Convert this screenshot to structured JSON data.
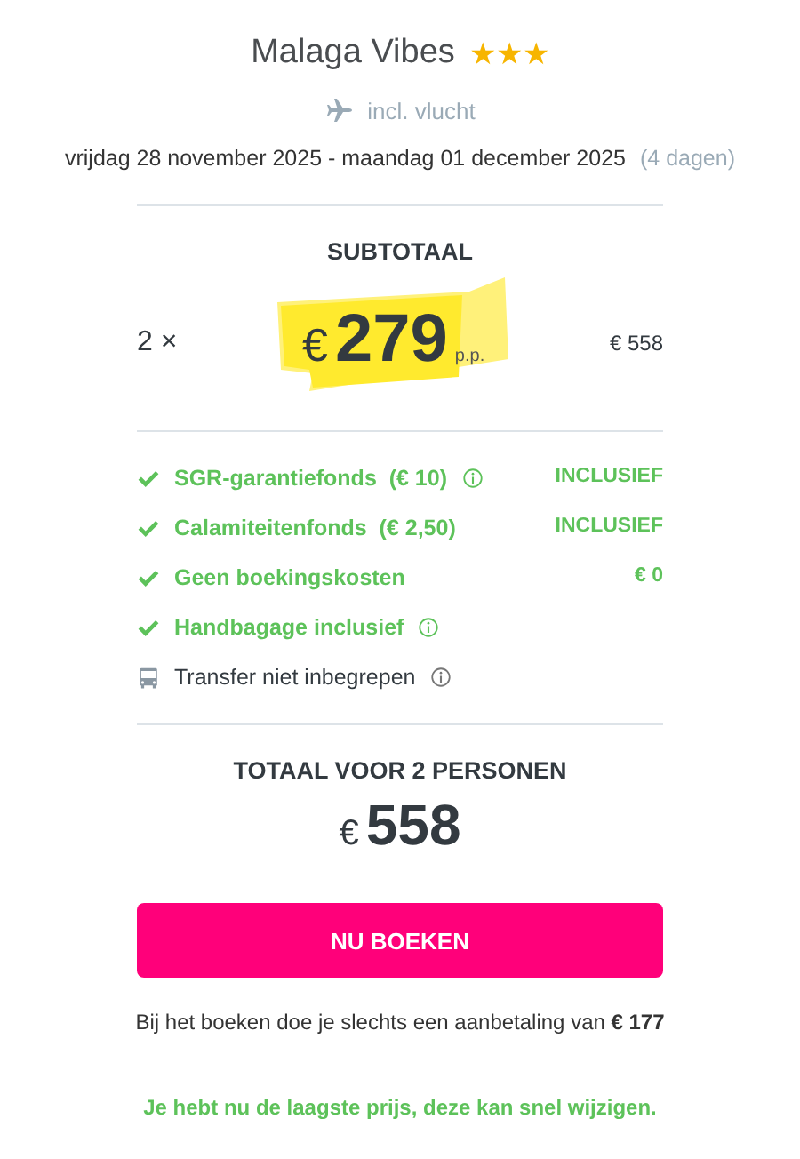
{
  "hotel": {
    "name": "Malaga Vibes",
    "stars": 3
  },
  "flight": {
    "label": "incl. vlucht"
  },
  "dates": {
    "range": "vrijdag 28 november 2025 - maandag 01 december 2025",
    "duration": "(4 dagen)"
  },
  "subtotal": {
    "title": "SUBTOTAAL",
    "quantity": "2 ×",
    "currency": "€",
    "price": "279",
    "unit": "p.p.",
    "amount": "€ 558"
  },
  "features": [
    {
      "kind": "included",
      "label": "SGR-garantiefonds  (€ 10)",
      "info": true,
      "value": "INCLUSIEF"
    },
    {
      "kind": "included",
      "label": "Calamiteitenfonds  (€ 2,50)",
      "info": false,
      "value": "INCLUSIEF"
    },
    {
      "kind": "included",
      "label": "Geen boekingskosten",
      "info": false,
      "value": "€ 0"
    },
    {
      "kind": "included",
      "label": "Handbagage inclusief",
      "info": true
    },
    {
      "kind": "excluded",
      "label": "Transfer niet inbegrepen",
      "info": true
    }
  ],
  "total": {
    "title": "TOTAAL VOOR 2 PERSONEN",
    "currency": "€",
    "amount": "558"
  },
  "book_button": "NU BOEKEN",
  "deposit_note": "Bij het boeken doe je slechts een aanbetaling van **€ 177**",
  "price_note": "Je hebt nu de laagste prijs, deze kan snel wijzigen."
}
